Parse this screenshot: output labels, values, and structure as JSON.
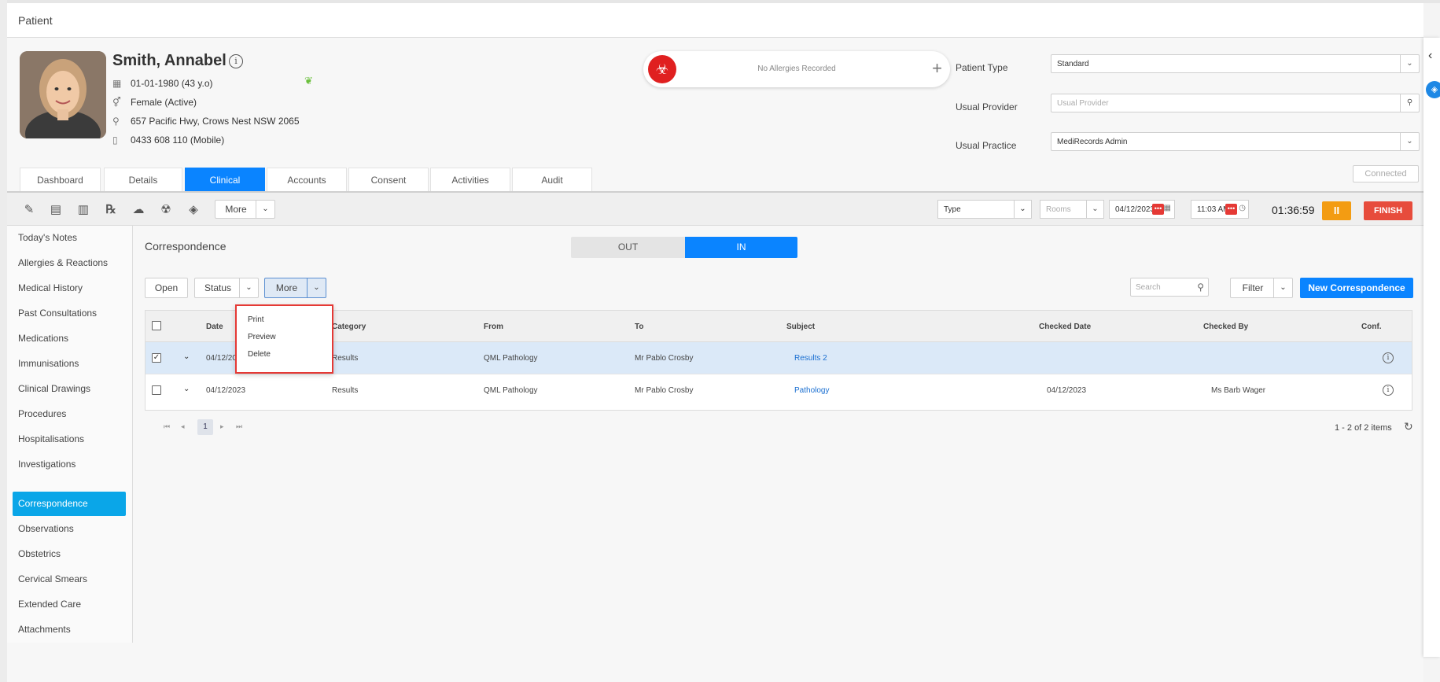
{
  "window": {
    "title": "Patient"
  },
  "patient": {
    "name": "Smith, Annabel",
    "dob": "01-01-1980 (43 y.o)",
    "gender": "Female (Active)",
    "address": "657 Pacific Hwy, Crows Nest NSW 2065",
    "phone": "0433 608 110 (Mobile)"
  },
  "allergy": {
    "text": "No Allergies Recorded"
  },
  "fields": {
    "patient_type_label": "Patient Type",
    "patient_type_value": "Standard",
    "usual_provider_label": "Usual Provider",
    "usual_provider_placeholder": "Usual Provider",
    "usual_practice_label": "Usual Practice",
    "usual_practice_value": "MediRecords Admin",
    "connected_label": "Connected"
  },
  "tabs": [
    "Dashboard",
    "Details",
    "Clinical",
    "Accounts",
    "Consent",
    "Activities",
    "Audit"
  ],
  "toolbar": {
    "more_label": "More",
    "type_value": "Type",
    "rooms_placeholder": "Rooms",
    "date_value": "04/12/2023",
    "time_value": "11:03 AM",
    "timer": "01:36:59",
    "pause_label": "II",
    "finish_label": "FINISH"
  },
  "sidenav": [
    "Today's Notes",
    "Allergies & Reactions",
    "Medical History",
    "Past Consultations",
    "Medications",
    "Immunisations",
    "Clinical Drawings",
    "Procedures",
    "Hospitalisations",
    "Investigations",
    "Correspondence",
    "Observations",
    "Obstetrics",
    "Cervical Smears",
    "Extended Care",
    "Attachments"
  ],
  "main": {
    "title": "Correspondence",
    "toggle_out": "OUT",
    "toggle_in": "IN",
    "open_label": "Open",
    "status_label": "Status",
    "more_label": "More",
    "search_placeholder": "Search",
    "filter_label": "Filter",
    "new_label": "New Correspondence"
  },
  "table": {
    "columns": [
      "Date",
      "Category",
      "From",
      "To",
      "Subject",
      "Checked Date",
      "Checked By",
      "Conf."
    ],
    "rows": [
      {
        "date": "04/12/2023",
        "category": "Results",
        "from": "QML Pathology",
        "to": "Mr Pablo Crosby",
        "subject": "Results 2",
        "checked_date": "",
        "checked_by": "",
        "checked": true
      },
      {
        "date": "04/12/2023",
        "category": "Results",
        "from": "QML Pathology",
        "to": "Mr Pablo Crosby",
        "subject": "Pathology",
        "checked_date": "04/12/2023",
        "checked_by": "Ms Barb Wager",
        "checked": false
      }
    ]
  },
  "pager": {
    "page": "1",
    "summary": "1 - 2 of 2 items"
  },
  "more_menu": [
    "Print",
    "Preview",
    "Delete"
  ],
  "colors": {
    "accent": "#0a84ff",
    "nav_active": "#0aa6e8",
    "finish": "#e74c3c",
    "pause": "#f39c12",
    "highlight_border": "#e53935"
  }
}
